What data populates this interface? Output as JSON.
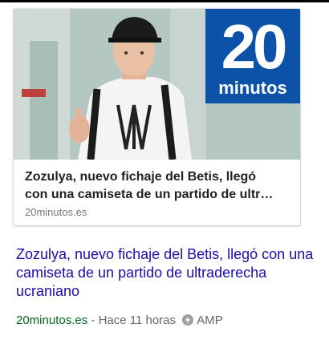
{
  "card": {
    "logo_number": "20",
    "logo_word": "minutos",
    "title_line1": "Zozulya, nuevo fichaje del Betis, llegó",
    "title_line2": "con una camiseta de un partido de ultr…",
    "source": "20minutos.es"
  },
  "result": {
    "title": "Zozulya, nuevo fichaje del Betis, llegó con una camiseta de un partido de ultraderecha ucraniano",
    "domain": "20minutos.es",
    "separator": " - ",
    "time": "Hace 11 horas",
    "amp_label": "AMP"
  },
  "colors": {
    "link": "#1a0dab",
    "domain": "#006621",
    "logo_bg": "#0c52a8"
  },
  "icons": {
    "amp": "lightning-bolt-icon"
  }
}
